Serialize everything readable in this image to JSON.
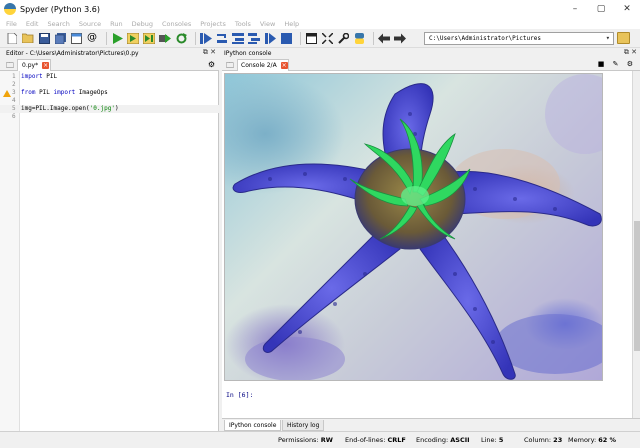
{
  "window": {
    "title": "Spyder (Python 3.6)",
    "controls": {
      "minimize": "–",
      "maximize": "▢",
      "close": "✕"
    }
  },
  "menu": [
    "File",
    "Edit",
    "Search",
    "Source",
    "Run",
    "Debug",
    "Consoles",
    "Projects",
    "Tools",
    "View",
    "Help"
  ],
  "toolbar": {
    "working_dir": "C:\\Users\\Administrator\\Pictures"
  },
  "editor": {
    "header": "Editor - C:\\Users\\Administrator\\Pictures\\0.py",
    "tab_label": "0.py*",
    "lines": [
      {
        "n": "1",
        "kw": "import",
        "rest": " PIL"
      },
      {
        "n": "2",
        "kw": "",
        "rest": ""
      },
      {
        "n": "3",
        "kw": "from",
        "rest": " PIL ",
        "kw2": "import",
        "rest2": " ImageOps"
      },
      {
        "n": "4",
        "kw": "",
        "rest": ""
      },
      {
        "n": "5",
        "kw": "",
        "rest": "img=PIL.Image.open(",
        "str": "'0.jpg'",
        "rest2": ")"
      },
      {
        "n": "6",
        "kw": "",
        "rest": ""
      }
    ]
  },
  "console": {
    "header": "IPython console",
    "tab_label": "Console 2/A",
    "prompt": "In [6]:",
    "bottom_tabs": [
      "IPython console",
      "History log"
    ]
  },
  "status": {
    "permissions_label": "Permissions:",
    "permissions": "RW",
    "eol_label": "End-of-lines:",
    "eol": "CRLF",
    "encoding_label": "Encoding:",
    "encoding": "ASCII",
    "line_label": "Line:",
    "line": "5",
    "column_label": "Column:",
    "column": "23",
    "memory_label": "Memory:",
    "memory": "62 %"
  },
  "colors": {
    "keyword": "#0000c0",
    "string": "#008000",
    "starfish": "#4848d8",
    "anemone": "#2fd860",
    "tab_close": "#e8542f"
  }
}
